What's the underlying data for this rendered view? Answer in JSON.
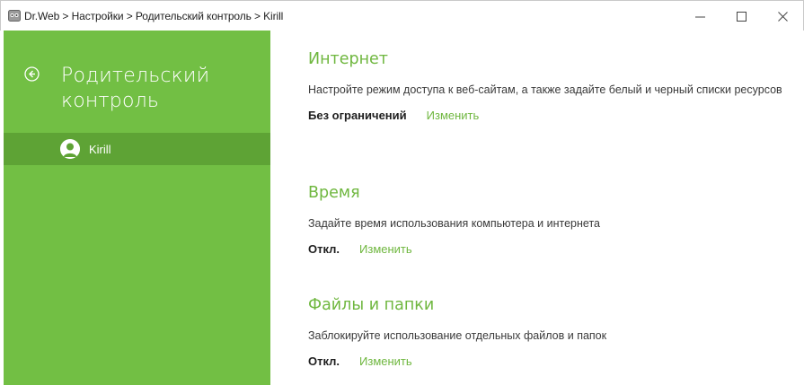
{
  "window": {
    "title": "Dr.Web > Настройки > Родительский контроль > Kirill",
    "minimize_icon": "minimize-icon",
    "maximize_icon": "maximize-icon",
    "close_icon": "close-icon"
  },
  "sidebar": {
    "title": "Родительский контроль",
    "back_icon": "back-arrow-icon",
    "items": [
      {
        "label": "Kirill",
        "icon": "user-avatar-icon"
      }
    ],
    "colors": {
      "background": "#72bf44",
      "selected": "#5ea335"
    }
  },
  "main": {
    "accent_color": "#6fb73f",
    "sections": [
      {
        "title": "Интернет",
        "description": "Настройте режим доступа к веб-сайтам, а также задайте белый и черный списки ресурсов",
        "status": "Без ограничений",
        "action": "Изменить"
      },
      {
        "title": "Время",
        "description": "Задайте время использования компьютера и интернета",
        "status": "Откл.",
        "action": "Изменить"
      },
      {
        "title": "Файлы и папки",
        "description": "Заблокируйте использование отдельных файлов и папок",
        "status": "Откл.",
        "action": "Изменить"
      }
    ]
  }
}
